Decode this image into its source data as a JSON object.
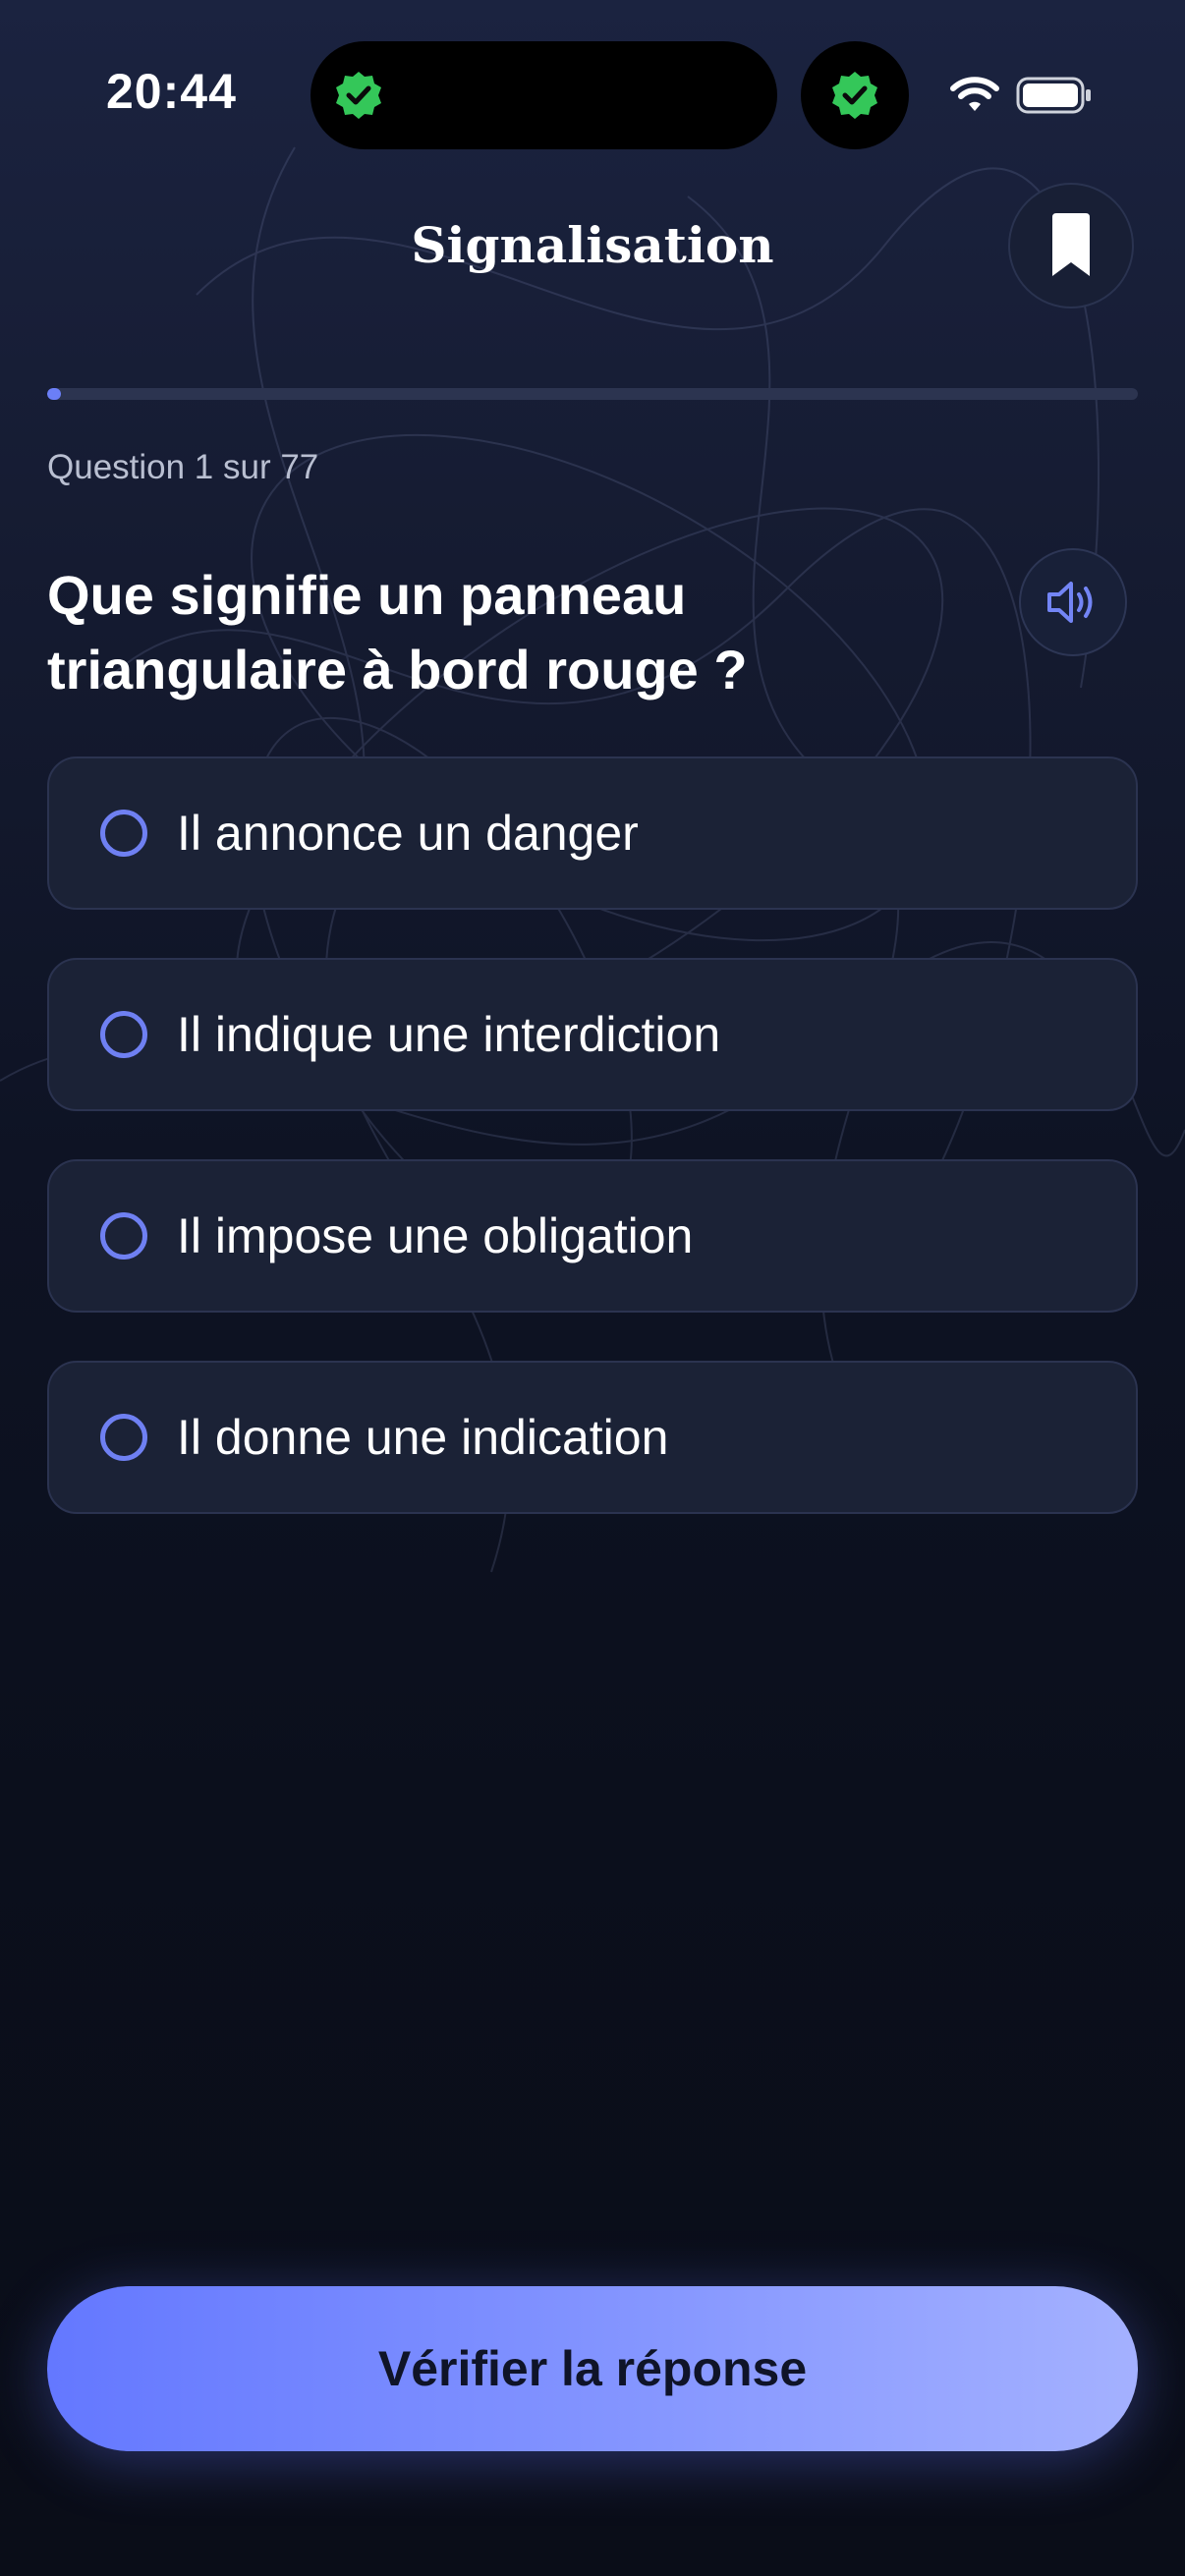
{
  "status_bar": {
    "time": "20:44"
  },
  "header": {
    "title": "Signalisation",
    "bookmark_icon": "bookmark-icon"
  },
  "progress": {
    "fraction": 0.013,
    "counter_text": "Question 1 sur 77"
  },
  "question": {
    "text": "Que signifie un panneau triangulaire à bord rouge ?",
    "audio_icon": "speaker-icon"
  },
  "options": [
    {
      "label": "Il annonce un danger"
    },
    {
      "label": "Il indique une interdiction"
    },
    {
      "label": "Il impose une obligation"
    },
    {
      "label": "Il donne une indication"
    }
  ],
  "actions": {
    "verify_label": "Vérifier la réponse"
  },
  "colors": {
    "accent": "#6b7ff7",
    "badge_green": "#34c759",
    "option_bg": "#1b2236"
  }
}
